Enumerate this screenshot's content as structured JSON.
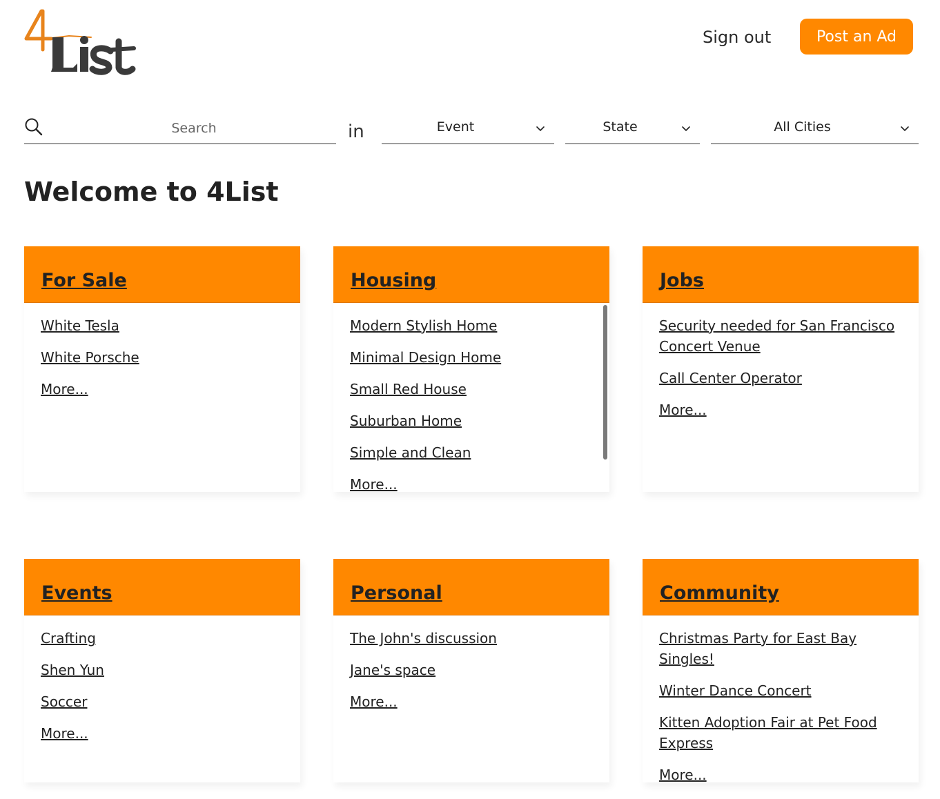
{
  "header": {
    "logo_text": "4List",
    "signout_label": "Sign out",
    "post_ad_label": "Post an Ad"
  },
  "search": {
    "placeholder": "Search",
    "in_label": "in",
    "category_select": "Event",
    "state_select": "State",
    "city_select": "All Cities"
  },
  "welcome": "Welcome to 4List",
  "colors": {
    "accent": "#ff8800",
    "text": "#222222",
    "background": "#ffffff"
  },
  "icons": [
    "search-icon",
    "chevron-down-icon"
  ],
  "cards": [
    {
      "title": "For Sale",
      "items": [
        "White Tesla",
        "White Porsche",
        "More..."
      ]
    },
    {
      "title": "Housing",
      "items": [
        "Modern Stylish Home",
        "Minimal Design Home",
        "Small Red House",
        "Suburban Home",
        "Simple and Clean",
        "More..."
      ]
    },
    {
      "title": "Jobs",
      "items": [
        "Security needed for San Francisco Concert Venue",
        "Call Center Operator",
        "More..."
      ]
    },
    {
      "title": "Events",
      "items": [
        "Crafting",
        "Shen Yun",
        "Soccer",
        "More..."
      ]
    },
    {
      "title": "Personal",
      "items": [
        "The John's discussion",
        "Jane's space",
        "More..."
      ]
    },
    {
      "title": "Community",
      "items": [
        "Christmas Party for East Bay Singles!",
        "Winter Dance Concert",
        "Kitten Adoption Fair at Pet Food Express",
        "More..."
      ]
    }
  ]
}
